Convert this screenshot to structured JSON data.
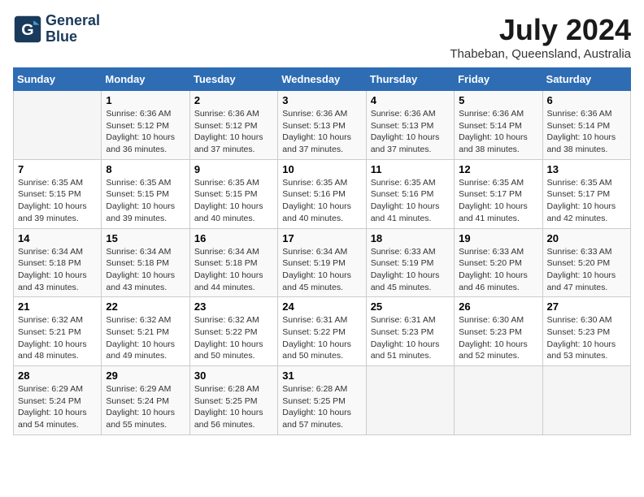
{
  "logo": {
    "text_line1": "General",
    "text_line2": "Blue"
  },
  "title": "July 2024",
  "subtitle": "Thabeban, Queensland, Australia",
  "headers": [
    "Sunday",
    "Monday",
    "Tuesday",
    "Wednesday",
    "Thursday",
    "Friday",
    "Saturday"
  ],
  "weeks": [
    [
      {
        "day": "",
        "sunrise": "",
        "sunset": "",
        "daylight": ""
      },
      {
        "day": "1",
        "sunrise": "Sunrise: 6:36 AM",
        "sunset": "Sunset: 5:12 PM",
        "daylight": "Daylight: 10 hours and 36 minutes."
      },
      {
        "day": "2",
        "sunrise": "Sunrise: 6:36 AM",
        "sunset": "Sunset: 5:12 PM",
        "daylight": "Daylight: 10 hours and 37 minutes."
      },
      {
        "day": "3",
        "sunrise": "Sunrise: 6:36 AM",
        "sunset": "Sunset: 5:13 PM",
        "daylight": "Daylight: 10 hours and 37 minutes."
      },
      {
        "day": "4",
        "sunrise": "Sunrise: 6:36 AM",
        "sunset": "Sunset: 5:13 PM",
        "daylight": "Daylight: 10 hours and 37 minutes."
      },
      {
        "day": "5",
        "sunrise": "Sunrise: 6:36 AM",
        "sunset": "Sunset: 5:14 PM",
        "daylight": "Daylight: 10 hours and 38 minutes."
      },
      {
        "day": "6",
        "sunrise": "Sunrise: 6:36 AM",
        "sunset": "Sunset: 5:14 PM",
        "daylight": "Daylight: 10 hours and 38 minutes."
      }
    ],
    [
      {
        "day": "7",
        "sunrise": "Sunrise: 6:35 AM",
        "sunset": "Sunset: 5:15 PM",
        "daylight": "Daylight: 10 hours and 39 minutes."
      },
      {
        "day": "8",
        "sunrise": "Sunrise: 6:35 AM",
        "sunset": "Sunset: 5:15 PM",
        "daylight": "Daylight: 10 hours and 39 minutes."
      },
      {
        "day": "9",
        "sunrise": "Sunrise: 6:35 AM",
        "sunset": "Sunset: 5:15 PM",
        "daylight": "Daylight: 10 hours and 40 minutes."
      },
      {
        "day": "10",
        "sunrise": "Sunrise: 6:35 AM",
        "sunset": "Sunset: 5:16 PM",
        "daylight": "Daylight: 10 hours and 40 minutes."
      },
      {
        "day": "11",
        "sunrise": "Sunrise: 6:35 AM",
        "sunset": "Sunset: 5:16 PM",
        "daylight": "Daylight: 10 hours and 41 minutes."
      },
      {
        "day": "12",
        "sunrise": "Sunrise: 6:35 AM",
        "sunset": "Sunset: 5:17 PM",
        "daylight": "Daylight: 10 hours and 41 minutes."
      },
      {
        "day": "13",
        "sunrise": "Sunrise: 6:35 AM",
        "sunset": "Sunset: 5:17 PM",
        "daylight": "Daylight: 10 hours and 42 minutes."
      }
    ],
    [
      {
        "day": "14",
        "sunrise": "Sunrise: 6:34 AM",
        "sunset": "Sunset: 5:18 PM",
        "daylight": "Daylight: 10 hours and 43 minutes."
      },
      {
        "day": "15",
        "sunrise": "Sunrise: 6:34 AM",
        "sunset": "Sunset: 5:18 PM",
        "daylight": "Daylight: 10 hours and 43 minutes."
      },
      {
        "day": "16",
        "sunrise": "Sunrise: 6:34 AM",
        "sunset": "Sunset: 5:18 PM",
        "daylight": "Daylight: 10 hours and 44 minutes."
      },
      {
        "day": "17",
        "sunrise": "Sunrise: 6:34 AM",
        "sunset": "Sunset: 5:19 PM",
        "daylight": "Daylight: 10 hours and 45 minutes."
      },
      {
        "day": "18",
        "sunrise": "Sunrise: 6:33 AM",
        "sunset": "Sunset: 5:19 PM",
        "daylight": "Daylight: 10 hours and 45 minutes."
      },
      {
        "day": "19",
        "sunrise": "Sunrise: 6:33 AM",
        "sunset": "Sunset: 5:20 PM",
        "daylight": "Daylight: 10 hours and 46 minutes."
      },
      {
        "day": "20",
        "sunrise": "Sunrise: 6:33 AM",
        "sunset": "Sunset: 5:20 PM",
        "daylight": "Daylight: 10 hours and 47 minutes."
      }
    ],
    [
      {
        "day": "21",
        "sunrise": "Sunrise: 6:32 AM",
        "sunset": "Sunset: 5:21 PM",
        "daylight": "Daylight: 10 hours and 48 minutes."
      },
      {
        "day": "22",
        "sunrise": "Sunrise: 6:32 AM",
        "sunset": "Sunset: 5:21 PM",
        "daylight": "Daylight: 10 hours and 49 minutes."
      },
      {
        "day": "23",
        "sunrise": "Sunrise: 6:32 AM",
        "sunset": "Sunset: 5:22 PM",
        "daylight": "Daylight: 10 hours and 50 minutes."
      },
      {
        "day": "24",
        "sunrise": "Sunrise: 6:31 AM",
        "sunset": "Sunset: 5:22 PM",
        "daylight": "Daylight: 10 hours and 50 minutes."
      },
      {
        "day": "25",
        "sunrise": "Sunrise: 6:31 AM",
        "sunset": "Sunset: 5:23 PM",
        "daylight": "Daylight: 10 hours and 51 minutes."
      },
      {
        "day": "26",
        "sunrise": "Sunrise: 6:30 AM",
        "sunset": "Sunset: 5:23 PM",
        "daylight": "Daylight: 10 hours and 52 minutes."
      },
      {
        "day": "27",
        "sunrise": "Sunrise: 6:30 AM",
        "sunset": "Sunset: 5:23 PM",
        "daylight": "Daylight: 10 hours and 53 minutes."
      }
    ],
    [
      {
        "day": "28",
        "sunrise": "Sunrise: 6:29 AM",
        "sunset": "Sunset: 5:24 PM",
        "daylight": "Daylight: 10 hours and 54 minutes."
      },
      {
        "day": "29",
        "sunrise": "Sunrise: 6:29 AM",
        "sunset": "Sunset: 5:24 PM",
        "daylight": "Daylight: 10 hours and 55 minutes."
      },
      {
        "day": "30",
        "sunrise": "Sunrise: 6:28 AM",
        "sunset": "Sunset: 5:25 PM",
        "daylight": "Daylight: 10 hours and 56 minutes."
      },
      {
        "day": "31",
        "sunrise": "Sunrise: 6:28 AM",
        "sunset": "Sunset: 5:25 PM",
        "daylight": "Daylight: 10 hours and 57 minutes."
      },
      {
        "day": "",
        "sunrise": "",
        "sunset": "",
        "daylight": ""
      },
      {
        "day": "",
        "sunrise": "",
        "sunset": "",
        "daylight": ""
      },
      {
        "day": "",
        "sunrise": "",
        "sunset": "",
        "daylight": ""
      }
    ]
  ]
}
